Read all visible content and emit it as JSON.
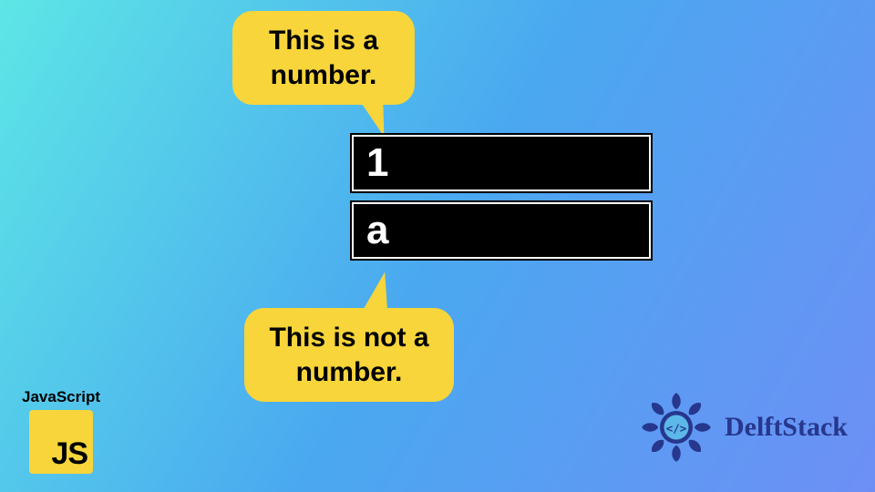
{
  "bubbles": {
    "top": "This is a number.",
    "bottom": "This is not a number."
  },
  "fields": {
    "first": "1",
    "second": "a"
  },
  "badges": {
    "js_label": "JavaScript",
    "js_glyph": "JS"
  },
  "brand": {
    "name": "DelftStack"
  },
  "colors": {
    "bubble": "#f7d53b",
    "field_bg": "#000000",
    "field_fg": "#ffffff",
    "brand": "#26378d"
  }
}
